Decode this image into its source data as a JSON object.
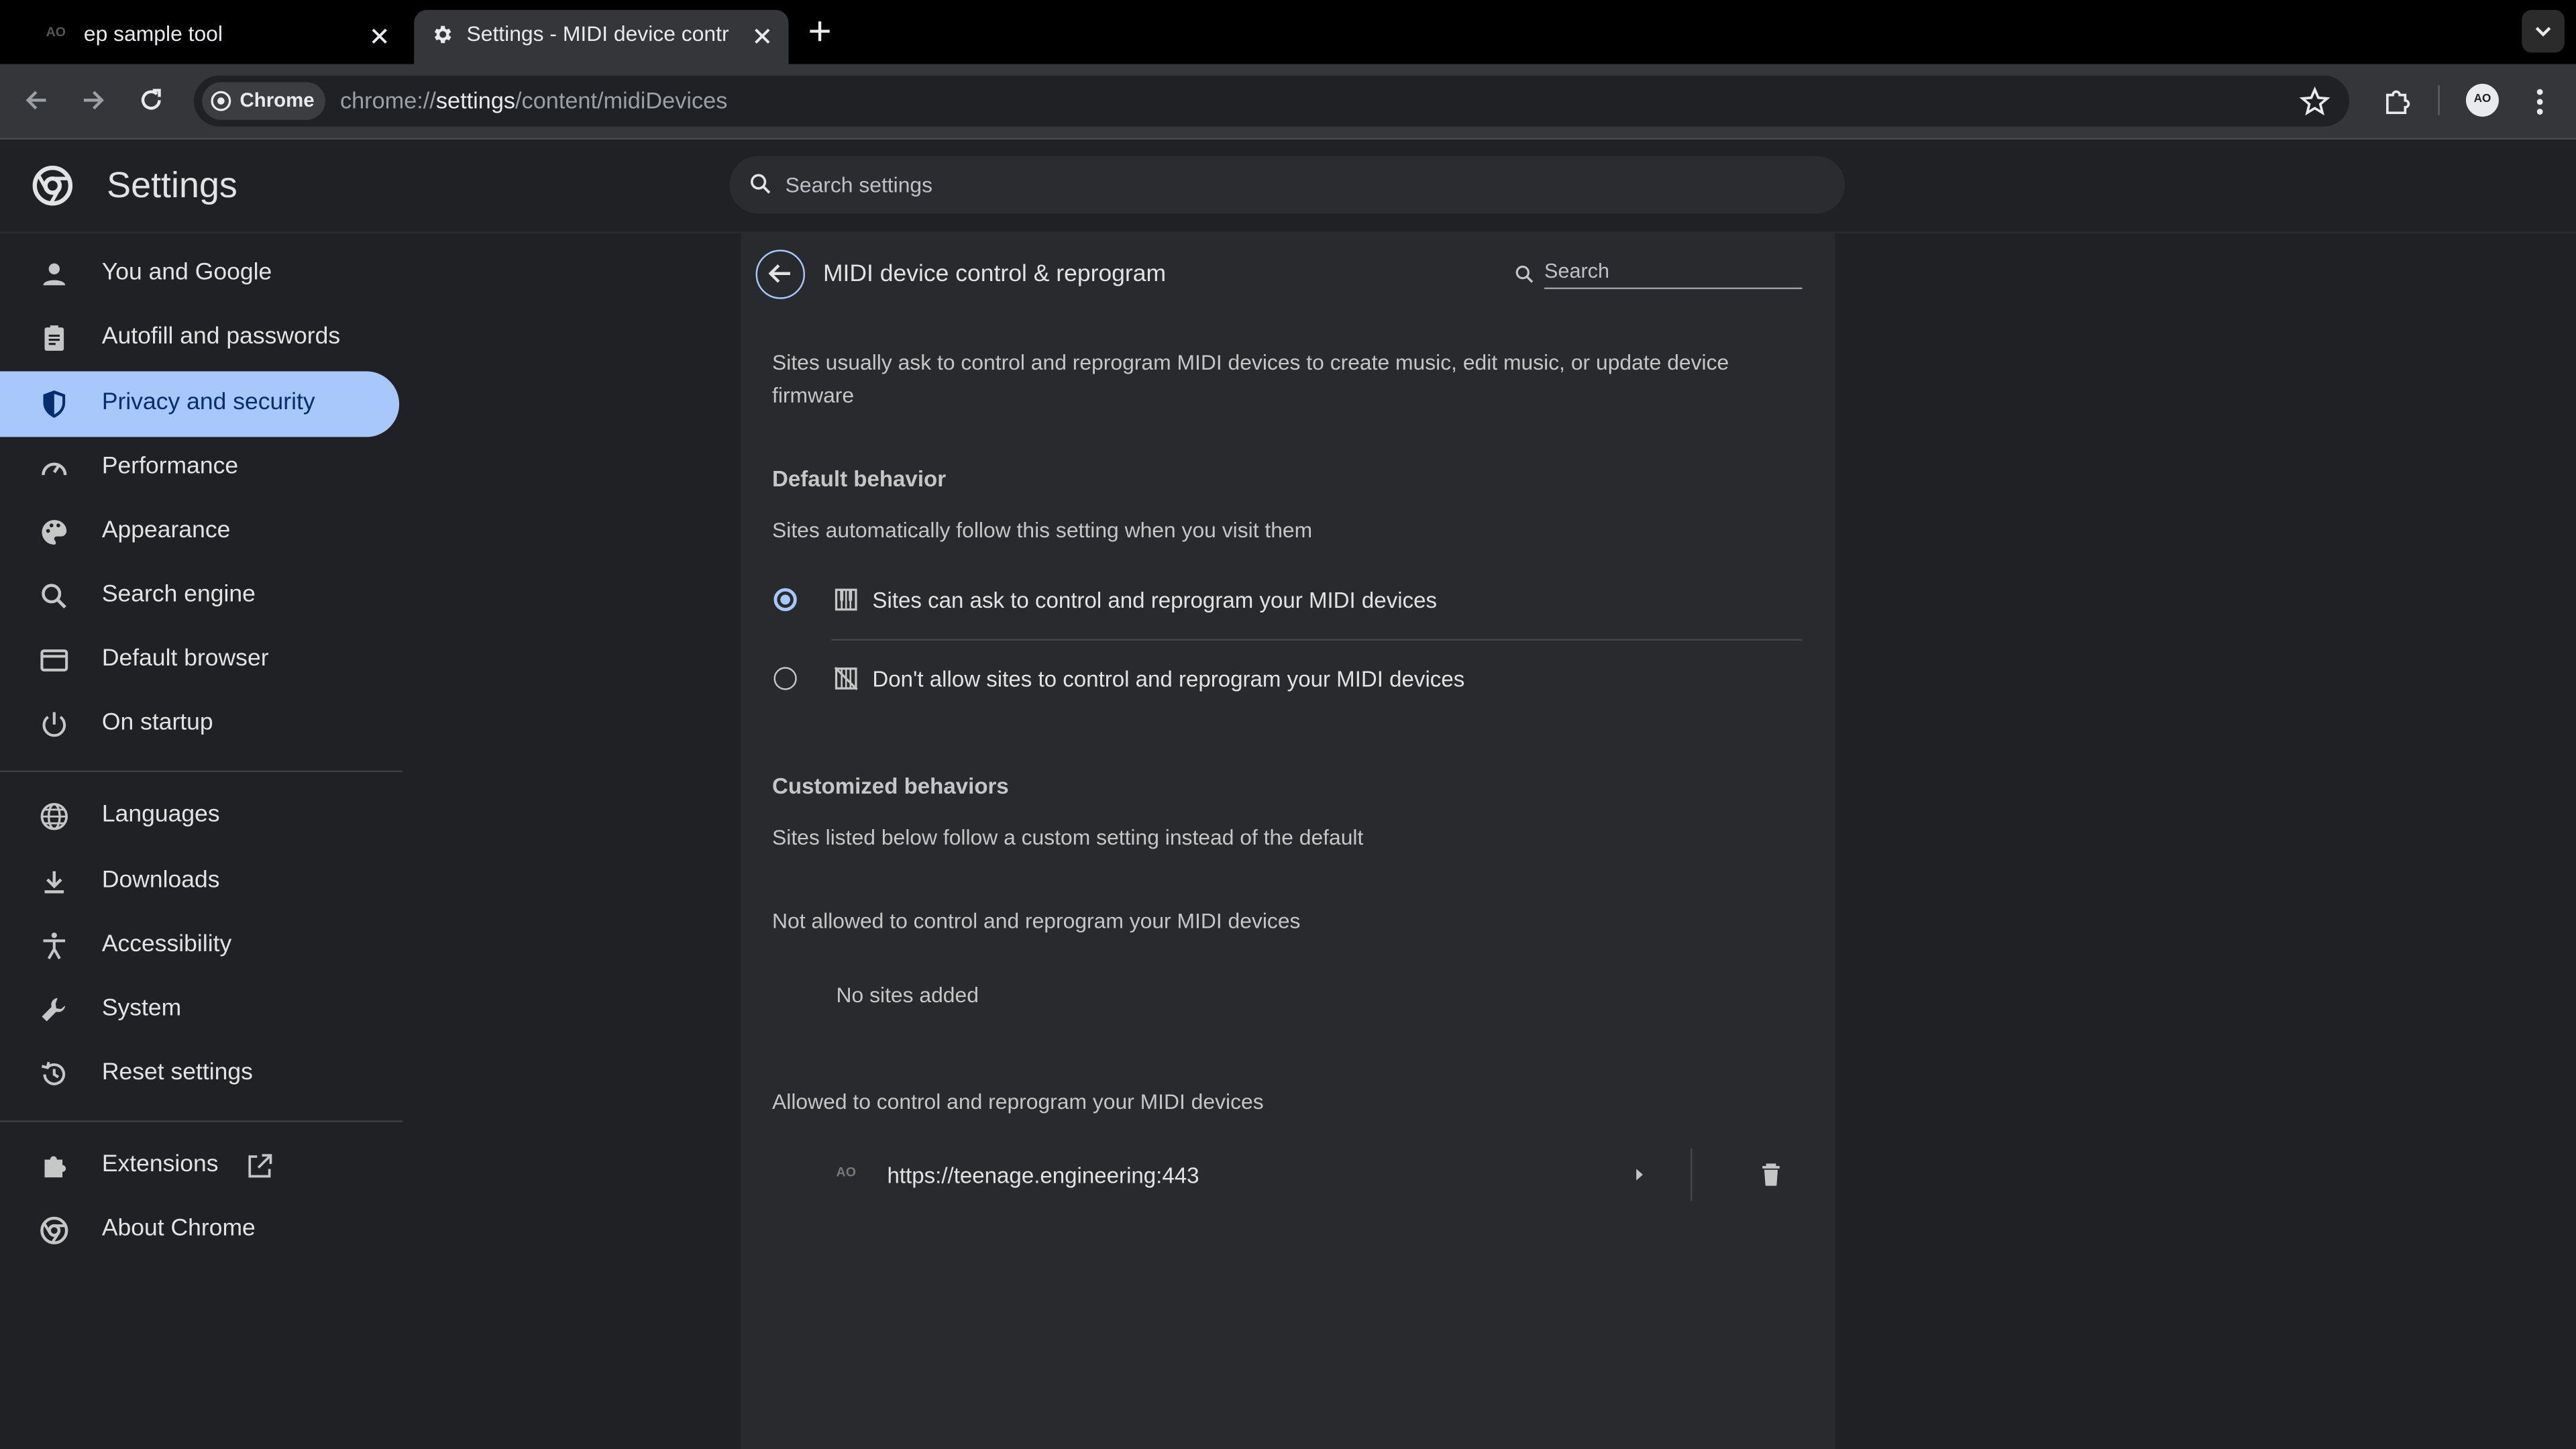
{
  "tabs": [
    {
      "title": "ep sample tool",
      "favicon": "AO",
      "active": false
    },
    {
      "title": "Settings - MIDI device control & reprogram",
      "favicon": "gear-icon",
      "active": true
    }
  ],
  "toolbar": {
    "chip_label": "Chrome",
    "url_scheme": "chrome://",
    "url_host": "settings",
    "url_path": "/content/midiDevices",
    "avatar": "AO"
  },
  "header": {
    "title": "Settings",
    "search_placeholder": "Search settings"
  },
  "sidebar": {
    "items": [
      {
        "label": "You and Google",
        "icon": "person-icon"
      },
      {
        "label": "Autofill and passwords",
        "icon": "clipboard-icon"
      },
      {
        "label": "Privacy and security",
        "icon": "shield-icon",
        "active": true
      },
      {
        "label": "Performance",
        "icon": "speedometer-icon"
      },
      {
        "label": "Appearance",
        "icon": "palette-icon"
      },
      {
        "label": "Search engine",
        "icon": "search-icon"
      },
      {
        "label": "Default browser",
        "icon": "browser-icon"
      },
      {
        "label": "On startup",
        "icon": "power-icon"
      },
      {
        "label": "Languages",
        "icon": "globe-icon"
      },
      {
        "label": "Downloads",
        "icon": "download-icon"
      },
      {
        "label": "Accessibility",
        "icon": "accessibility-icon"
      },
      {
        "label": "System",
        "icon": "wrench-icon"
      },
      {
        "label": "Reset settings",
        "icon": "history-icon"
      },
      {
        "label": "Extensions",
        "icon": "puzzle-icon"
      },
      {
        "label": "About Chrome",
        "icon": "chrome-icon"
      }
    ]
  },
  "page": {
    "title": "MIDI device control & reprogram",
    "search_placeholder": "Search",
    "description_line1": "Sites usually ask to control and reprogram MIDI devices to create music, edit music, or update device",
    "description_line2": "firmware",
    "default_behavior_header": "Default behavior",
    "default_behavior_sub": "Sites automatically follow this setting when you visit them",
    "option_allow": "Sites can ask to control and reprogram your MIDI devices",
    "option_block": "Don't allow sites to control and reprogram your MIDI devices",
    "selected_option": "allow",
    "customized_header": "Customized behaviors",
    "customized_sub": "Sites listed below follow a custom setting instead of the default",
    "not_allowed_header": "Not allowed to control and reprogram your MIDI devices",
    "no_sites": "No sites added",
    "allowed_header": "Allowed to control and reprogram your MIDI devices",
    "allowed_sites": [
      {
        "url": "https://teenage.engineering:443",
        "favicon": "AO"
      }
    ]
  },
  "colors": {
    "accent": "#a8c7fa",
    "active_text": "#062e6f",
    "background": "#202124",
    "card": "#292a2d"
  }
}
